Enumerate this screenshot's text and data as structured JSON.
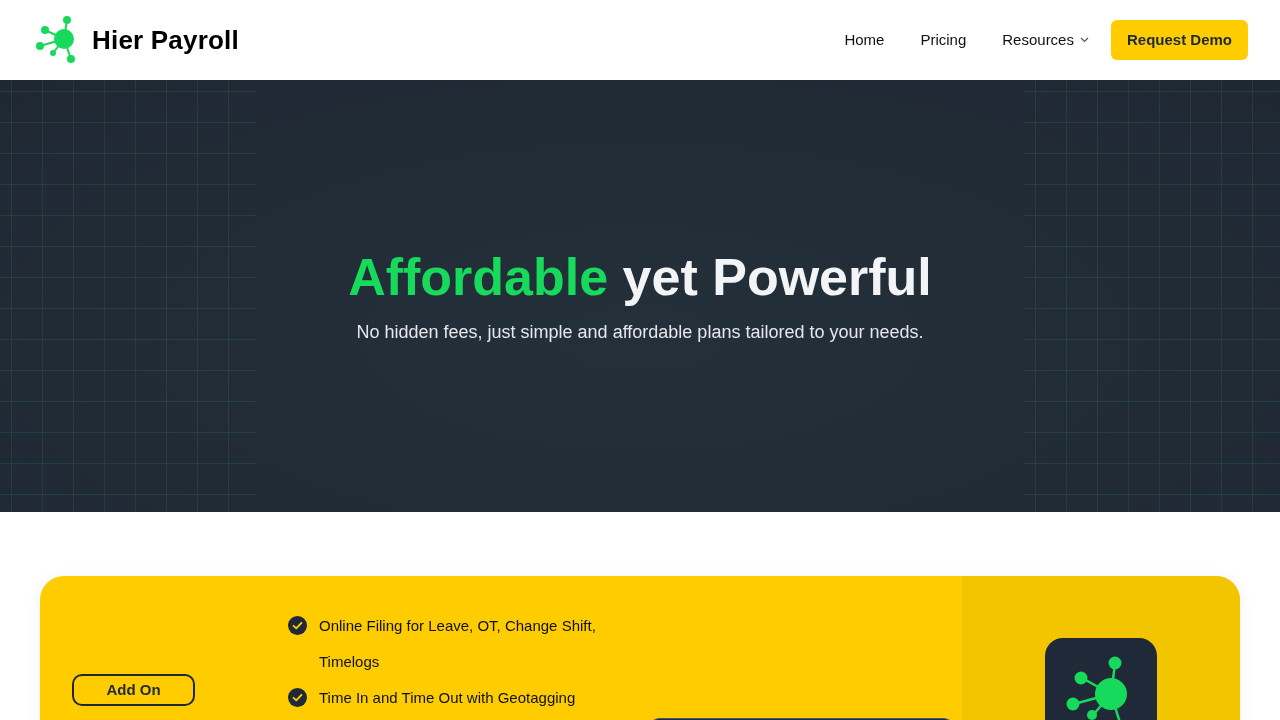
{
  "brand": {
    "name": "Hier Payroll"
  },
  "nav": {
    "links": [
      {
        "label": "Home",
        "dropdown": false
      },
      {
        "label": "Pricing",
        "dropdown": false
      },
      {
        "label": "Resources",
        "dropdown": true
      }
    ],
    "cta": "Request Demo"
  },
  "hero": {
    "title_highlight": "Affordable",
    "title_rest": "yet Powerful",
    "subtitle": "No hidden fees, just simple and affordable plans tailored to your needs."
  },
  "plan": {
    "tag": "Add On",
    "features": [
      "Online Filing for Leave, OT, Change Shift, Timelogs",
      "Time In and Time Out with Geotagging"
    ]
  }
}
